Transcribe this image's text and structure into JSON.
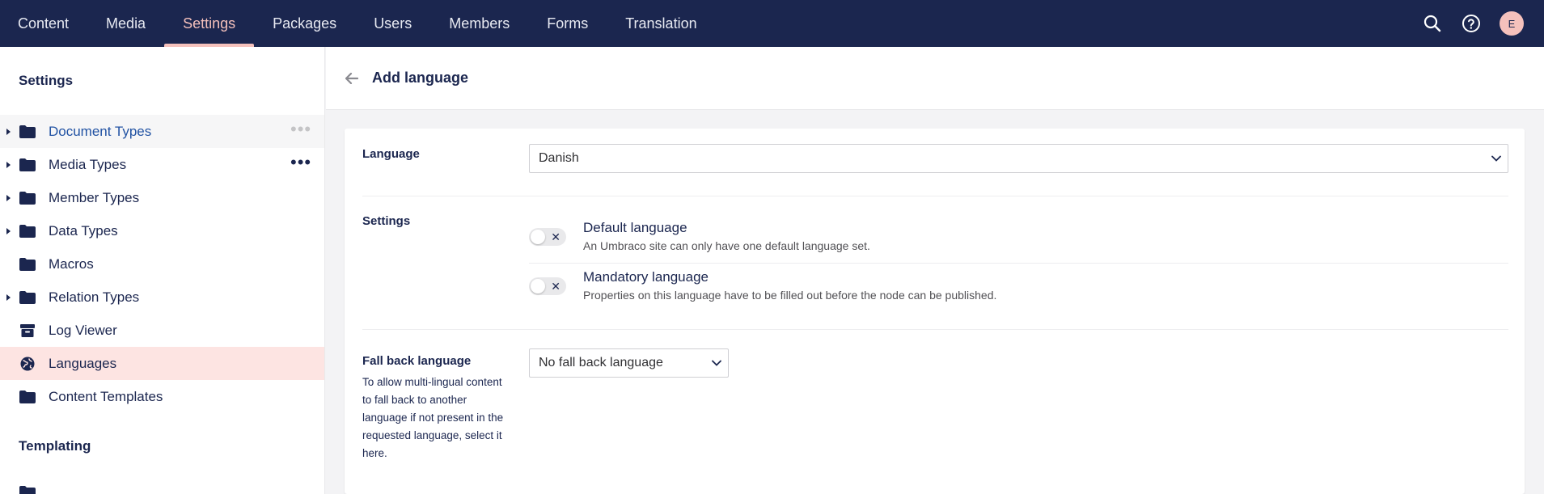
{
  "topnav": {
    "items": [
      "Content",
      "Media",
      "Settings",
      "Packages",
      "Users",
      "Members",
      "Forms",
      "Translation"
    ],
    "active": "Settings",
    "avatar_initial": "E"
  },
  "sidebar": {
    "section_settings": "Settings",
    "items": [
      {
        "label": "Document Types",
        "icon": "folder-icon",
        "has_caret": true,
        "has_menu": true,
        "state": "hover"
      },
      {
        "label": "Media Types",
        "icon": "folder-icon",
        "has_caret": true,
        "has_menu": true,
        "state": ""
      },
      {
        "label": "Member Types",
        "icon": "folder-icon",
        "has_caret": true,
        "has_menu": false,
        "state": ""
      },
      {
        "label": "Data Types",
        "icon": "folder-icon",
        "has_caret": true,
        "has_menu": false,
        "state": ""
      },
      {
        "label": "Macros",
        "icon": "folder-icon",
        "has_caret": false,
        "has_menu": false,
        "state": ""
      },
      {
        "label": "Relation Types",
        "icon": "folder-icon",
        "has_caret": true,
        "has_menu": false,
        "state": ""
      },
      {
        "label": "Log Viewer",
        "icon": "box-icon",
        "has_caret": false,
        "has_menu": false,
        "state": ""
      },
      {
        "label": "Languages",
        "icon": "globe-icon",
        "has_caret": false,
        "has_menu": false,
        "state": "selected"
      },
      {
        "label": "Content Templates",
        "icon": "folder-icon",
        "has_caret": false,
        "has_menu": false,
        "state": ""
      }
    ],
    "section_templating": "Templating"
  },
  "main": {
    "title": "Add language",
    "language": {
      "label": "Language",
      "value": "Danish"
    },
    "settings": {
      "label": "Settings",
      "default_title": "Default language",
      "default_desc": "An Umbraco site can only have one default language set.",
      "mandatory_title": "Mandatory language",
      "mandatory_desc": "Properties on this language have to be filled out before the node can be published."
    },
    "fallback": {
      "label": "Fall back language",
      "help": "To allow multi-lingual content to fall back to another language if not present in the requested language, select it here.",
      "value": "No fall back language"
    }
  },
  "colors": {
    "topbar": "#1b264f",
    "active_accent": "#f5c1bc",
    "selected_bg": "#fde4e2"
  }
}
